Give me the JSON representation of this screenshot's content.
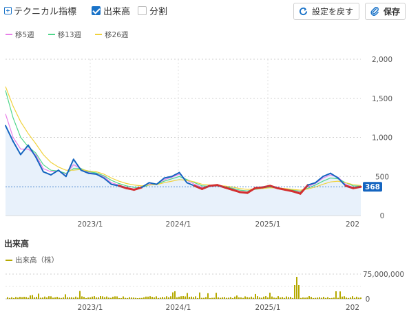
{
  "toolbar": {
    "technical_label": "テクニカル指標",
    "volume_label": "出来高",
    "volume_checked": true,
    "split_label": "分割",
    "split_checked": false,
    "reset_button": "設定を戻す",
    "save_button": "保存"
  },
  "legend": [
    {
      "label": "移5週",
      "color": "#e87fe8"
    },
    {
      "label": "移13週",
      "color": "#4fd68a"
    },
    {
      "label": "移26週",
      "color": "#f0d23c"
    }
  ],
  "price_axis": {
    "ticks": [
      "2,000",
      "1,500",
      "1,000",
      "500",
      "0"
    ]
  },
  "current_price": "368",
  "x_labels": [
    "2023/1",
    "2024/1",
    "2025/1",
    "202"
  ],
  "volume": {
    "title": "出来高",
    "legend_label": "出来高（株）",
    "legend_color": "#b5a900",
    "axis_ticks": [
      "75,000,000",
      "0"
    ]
  },
  "chart_data": {
    "type": "line",
    "ylim": [
      0,
      2000
    ],
    "series": [
      {
        "name": "",
        "x_dates": [
          "2022/1",
          "2022/2",
          "2022/3",
          "2022/4",
          "2022/5",
          "2022/6",
          "2022/7",
          "2022/8",
          "2022/9",
          "2022/10",
          "2022/11",
          "2022/12",
          "2023/1",
          "2023/2",
          "2023/3",
          "2023/4",
          "2023/5",
          "2023/6",
          "2023/7",
          "2023/8",
          "2023/9",
          "2023/10",
          "2023/11",
          "2023/12",
          "2024/1",
          "2024/2",
          "2024/3",
          "2024/4",
          "2024/5",
          "2024/6",
          "2024/7",
          "2024/8",
          "2024/9",
          "2024/10",
          "2024/11",
          "2024/12",
          "2025/1",
          "2025/2",
          "2025/3",
          "2025/4",
          "2025/5",
          "2025/6",
          "2025/7",
          "2025/8",
          "2025/9",
          "2025/10",
          "2025/11",
          "2025/12"
        ],
        "values": [
          1150,
          950,
          780,
          900,
          750,
          560,
          520,
          580,
          500,
          720,
          580,
          540,
          530,
          480,
          400,
          380,
          350,
          330,
          360,
          420,
          400,
          480,
          500,
          550,
          420,
          380,
          340,
          380,
          390,
          360,
          330,
          300,
          290,
          350,
          360,
          380,
          350,
          330,
          310,
          280,
          390,
          420,
          500,
          540,
          480,
          380,
          350,
          368
        ]
      }
    ],
    "moving_averages": [
      {
        "name": "移5週",
        "values": [
          1300,
          1000,
          850,
          850,
          780,
          600,
          560,
          570,
          530,
          650,
          600,
          550,
          540,
          500,
          420,
          390,
          360,
          340,
          355,
          400,
          405,
          460,
          490,
          530,
          450,
          400,
          360,
          370,
          380,
          365,
          340,
          310,
          300,
          340,
          355,
          370,
          355,
          335,
          315,
          300,
          370,
          410,
          480,
          520,
          490,
          400,
          360,
          370
        ]
      },
      {
        "name": "移13週",
        "values": [
          1600,
          1250,
          1000,
          880,
          800,
          650,
          580,
          570,
          540,
          600,
          600,
          560,
          545,
          510,
          450,
          410,
          380,
          360,
          360,
          390,
          400,
          440,
          470,
          500,
          460,
          420,
          380,
          375,
          380,
          370,
          350,
          325,
          315,
          335,
          345,
          360,
          355,
          340,
          325,
          310,
          350,
          390,
          440,
          480,
          470,
          420,
          380,
          375
        ]
      },
      {
        "name": "移26週",
        "values": [
          1650,
          1400,
          1200,
          1050,
          920,
          780,
          680,
          620,
          580,
          580,
          590,
          570,
          560,
          530,
          480,
          440,
          410,
          390,
          380,
          390,
          395,
          420,
          440,
          460,
          450,
          430,
          400,
          390,
          385,
          378,
          365,
          345,
          335,
          340,
          345,
          355,
          352,
          345,
          335,
          325,
          340,
          365,
          400,
          430,
          440,
          420,
          395,
          385
        ]
      }
    ]
  }
}
